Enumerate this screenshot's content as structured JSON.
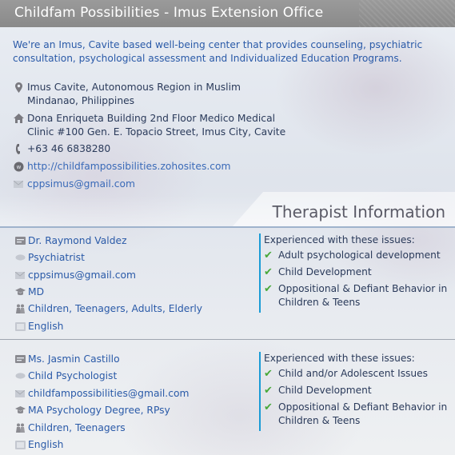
{
  "header": {
    "title": "Childfam Possibilities - Imus Extension Office"
  },
  "description": "We're an Imus, Cavite based well-being center that provides counseling, psychiatric consultation, psychological assessment and Individualized Education Programs.",
  "contact": {
    "region": "Imus Cavite, Autonomous Region in Muslim Mindanao, Philippines",
    "address": "Dona Enriqueta Building 2nd Floor Medico Medical Clinic #100 Gen. E. Topacio Street, Imus City, Cavite",
    "phone": "+63 46 6838280",
    "website": "http://childfampossibilities.zohosites.com",
    "email": "cppsimus@gmail.com"
  },
  "therapist_section": {
    "heading": "Therapist Information"
  },
  "therapists": [
    {
      "name": "Dr. Raymond Valdez",
      "title": "Psychiatrist",
      "email": "cppsimus@gmail.com",
      "credentials": "MD",
      "ages": "Children, Teenagers, Adults, Elderly",
      "language": "English",
      "issues_heading": "Experienced with these issues:",
      "issues": [
        "Adult psychological development",
        "Child Development",
        "Oppositional & Defiant Behavior in Children & Teens"
      ]
    },
    {
      "name": "Ms. Jasmin Castillo",
      "title": "Child Psychologist",
      "email": "childfampossibilities@gmail.com",
      "credentials": "MA Psychology Degree, RPsy",
      "ages": "Children, Teenagers",
      "language": "English",
      "issues_heading": "Experienced with these issues:",
      "issues": [
        "Child and/or Adolescent Issues",
        "Child Development",
        "Oppositional & Defiant Behavior in Children & Teens"
      ]
    }
  ],
  "icons": {
    "location": "map-pin-icon",
    "address": "home-icon",
    "phone": "phone-icon",
    "website": "globe-icon",
    "email": "envelope-icon",
    "name": "id-card-icon",
    "title": "speech-bubble-icon",
    "credentials": "graduation-cap-icon",
    "ages": "people-icon",
    "language": "language-icon",
    "check": "checkmark-icon"
  },
  "colors": {
    "accent": "#1a9bd6",
    "check": "#48a83a",
    "link": "#3a6ab8",
    "title_bar": "#8a8a8a"
  }
}
